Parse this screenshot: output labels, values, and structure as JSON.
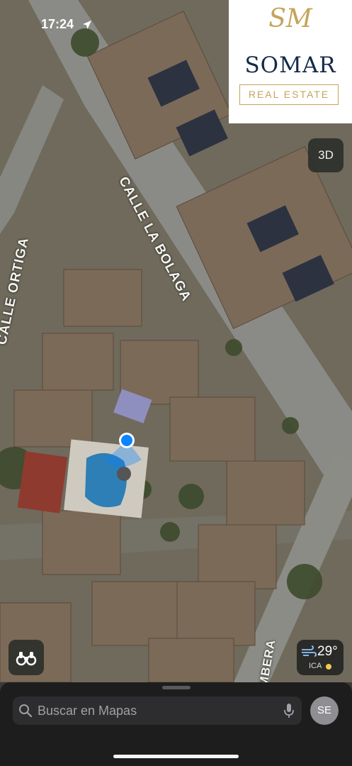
{
  "status_bar": {
    "time": "17:24"
  },
  "brand": {
    "monogram": "SM",
    "name": "SOMAR",
    "tagline": "REAL ESTATE"
  },
  "map": {
    "view_toggle_label": "3D",
    "streets": [
      "CALLE LA BOLAGA",
      "CALLE ORTIGA",
      "MBERA"
    ]
  },
  "weather": {
    "temperature": "29°",
    "air_quality_label": "ICA",
    "air_quality_color": "#f2c94c"
  },
  "search": {
    "placeholder": "Buscar en Mapas"
  },
  "account": {
    "initials": "SE"
  },
  "colors": {
    "brand_navy": "#14294b",
    "brand_gold": "#c5a45a",
    "location_blue": "#0a84ff"
  }
}
